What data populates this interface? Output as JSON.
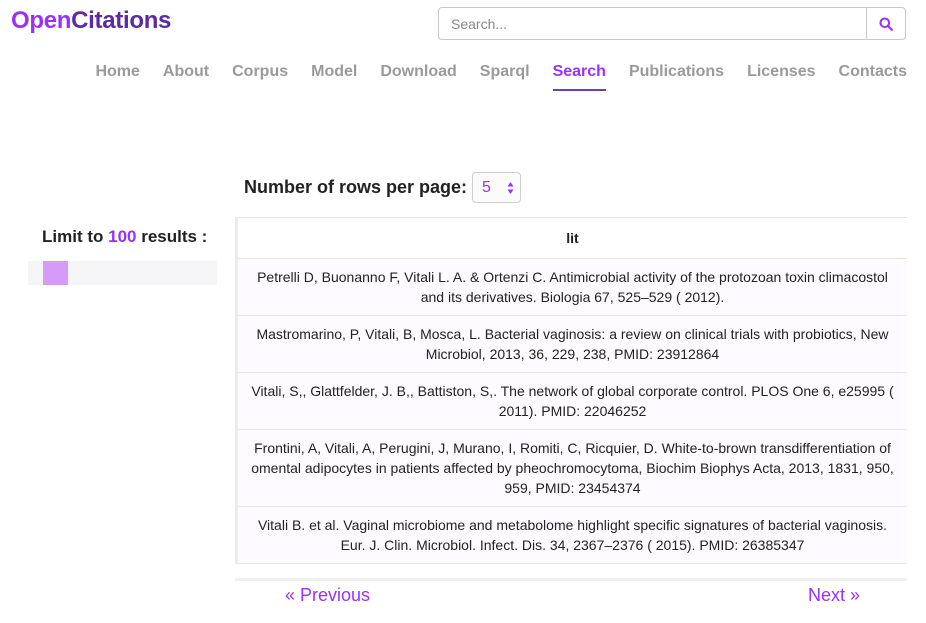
{
  "header": {
    "logo_open": "Open",
    "logo_citations": "Citations",
    "search_placeholder": "Search..."
  },
  "nav": {
    "items": [
      {
        "label": "Home"
      },
      {
        "label": "About"
      },
      {
        "label": "Corpus"
      },
      {
        "label": "Model"
      },
      {
        "label": "Download"
      },
      {
        "label": "Sparql"
      },
      {
        "label": "Search",
        "active": true
      },
      {
        "label": "Publications"
      },
      {
        "label": "Licenses"
      },
      {
        "label": "Contacts"
      }
    ]
  },
  "controls": {
    "rows_label": "Number of rows per page:",
    "rows_value": "5",
    "limit_prefix": "Limit to ",
    "limit_value": "100",
    "limit_suffix": " results :"
  },
  "table": {
    "header": "lit",
    "rows": [
      "Petrelli D, Buonanno F, Vitali L. A. & Ortenzi C. Antimicrobial activity of the protozoan toxin climacostol and its derivatives. Biologia 67, 525–529 ( 2012).",
      "Mastromarino, P, Vitali, B, Mosca, L. Bacterial vaginosis: a review on clinical trials with probiotics, New Microbiol, 2013, 36, 229, 238, PMID: 23912864",
      "Vitali, S,, Glattfelder, J. B,, Battiston, S,. The network of global corporate control. PLOS One 6, e25995 ( 2011). PMID: 22046252",
      "Frontini, A, Vitali, A, Perugini, J, Murano, I, Romiti, C, Ricquier, D. White-to-brown transdifferentiation of omental adipocytes in patients affected by pheochromocytoma, Biochim Biophys Acta, 2013, 1831, 950, 959, PMID: 23454374",
      "Vitali B. et al. Vaginal microbiome and metabolome highlight specific signatures of bacterial vaginosis. Eur. J. Clin. Microbiol. Infect. Dis. 34, 2367–2376 ( 2015). PMID: 26385347"
    ]
  },
  "pagination": {
    "prev": "« Previous",
    "next": "Next »"
  },
  "colors": {
    "accent": "#9931fc",
    "logo_dark": "#5b2ba6",
    "nav_inactive": "#9a9a9a",
    "slider_handle": "#d49cf6"
  }
}
